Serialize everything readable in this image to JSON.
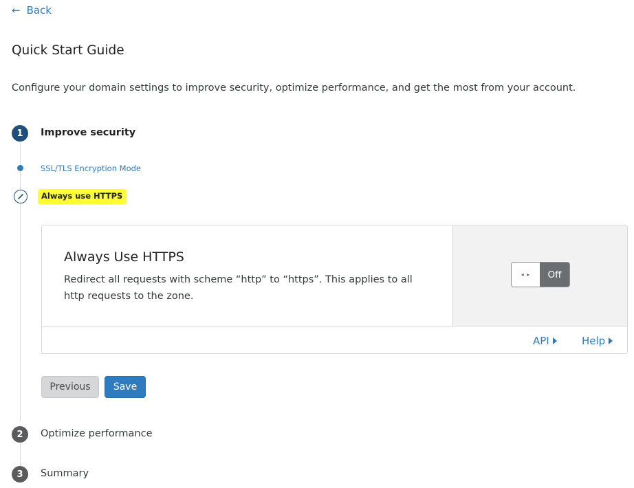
{
  "nav": {
    "back_arrow": "←",
    "back_label": "Back"
  },
  "page": {
    "title": "Quick Start Guide",
    "description": "Configure your domain settings to improve security, optimize performance, and get the most from your account."
  },
  "steps": [
    {
      "number": "1",
      "label": "Improve security",
      "state": "active"
    },
    {
      "number": "2",
      "label": "Optimize performance",
      "state": "inactive"
    },
    {
      "number": "3",
      "label": "Summary",
      "state": "inactive"
    }
  ],
  "substeps": [
    {
      "label": "SSL/TLS Encryption Mode",
      "state": "completed",
      "icon": "dot-icon"
    },
    {
      "label": "Always use HTTPS",
      "state": "current",
      "icon": "pencil-icon",
      "highlighted": true
    }
  ],
  "setting_card": {
    "title": "Always Use HTTPS",
    "description": "Redirect all requests with scheme “http” to “https”. This applies to all http requests to the zone.",
    "toggle": {
      "knob_glyph": "◂ ▸",
      "state_label": "Off"
    },
    "footer": {
      "api_label": "API",
      "help_label": "Help"
    }
  },
  "actions": {
    "previous_label": "Previous",
    "save_label": "Save"
  },
  "colors": {
    "link": "#2f7bbf",
    "active_step": "#1f4f7a",
    "inactive_step": "#595b5c",
    "highlight": "#ffff33",
    "primary_button": "#2f7bbf",
    "secondary_button": "#d5d7d8",
    "toggle_off": "#6b6e71"
  }
}
